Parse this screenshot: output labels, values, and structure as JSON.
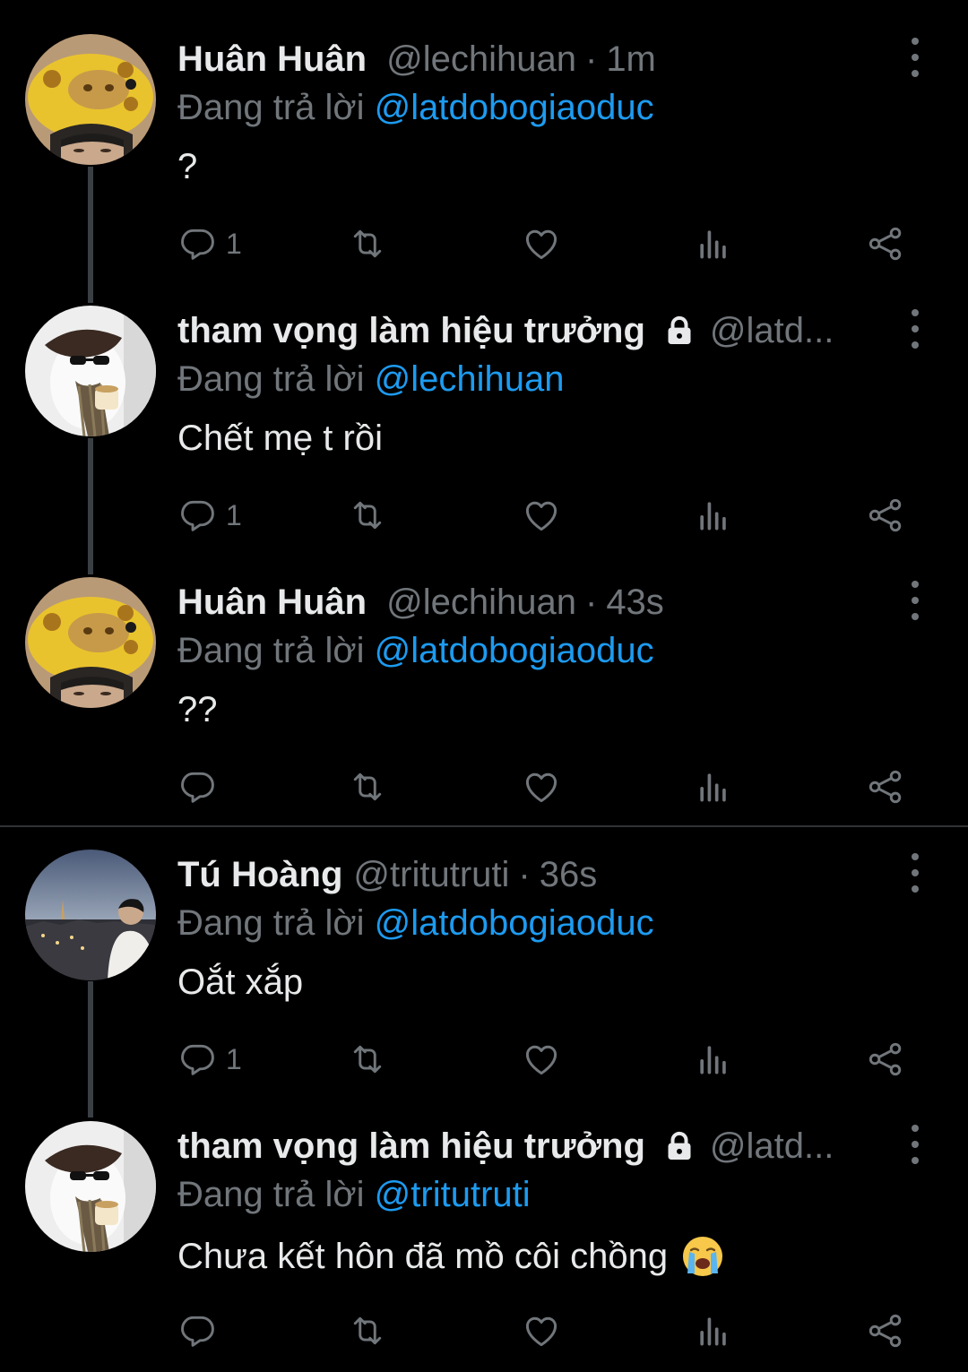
{
  "replying_label": "Đang trả lời",
  "tweets": [
    {
      "name": "Huân Huân",
      "handle": "@lechihuan",
      "separator": "·",
      "time": "1m",
      "reply_to": "@latdobogiaoduc",
      "text": "?",
      "reply_count": "1",
      "avatar": "giraffe-hat-avatar",
      "locked": false
    },
    {
      "name": "tham vọng làm hiệu trưởng",
      "handle": "@latd...",
      "separator": "",
      "time": "",
      "reply_to": "@lechihuan",
      "text": "Chết mẹ t rồi",
      "reply_count": "1",
      "avatar": "beret-cat-avatar",
      "locked": true
    },
    {
      "name": "Huân Huân",
      "handle": "@lechihuan",
      "separator": "·",
      "time": "43s",
      "reply_to": "@latdobogiaoduc",
      "text": "??",
      "reply_count": "",
      "avatar": "giraffe-hat-avatar",
      "locked": false
    },
    {
      "name": "Tú Hoàng",
      "handle": "@tritutruti",
      "separator": "·",
      "time": "36s",
      "reply_to": "@latdobogiaoduc",
      "text": "Oắt xắp",
      "reply_count": "1",
      "avatar": "city-view-avatar",
      "locked": false
    },
    {
      "name": "tham vọng làm hiệu trưởng",
      "handle": "@latd...",
      "separator": "",
      "time": "",
      "reply_to": "@tritutruti",
      "text": "Chưa kết hôn đã mồ côi chồng",
      "reply_count": "",
      "avatar": "beret-cat-avatar",
      "locked": true,
      "emoji": "loudly-crying-face-emoji"
    }
  ],
  "colors": {
    "background": "#000000",
    "text": "#e7e9ea",
    "muted": "#71767b",
    "link": "#1d9bf0",
    "thread_line": "#3a3f44"
  }
}
